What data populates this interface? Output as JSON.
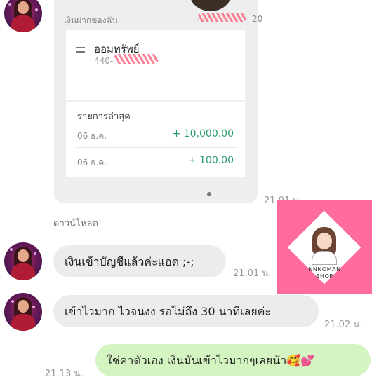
{
  "card": {
    "header_label": "เงินฝากของฉัน",
    "header_amount_suffix": "20",
    "account_name": "ออมทรัพย์",
    "account_number_prefix": "440-",
    "recent_title": "รายการล่าสุด",
    "transactions": [
      {
        "date": "06 ธ.ค.",
        "amount": "+ 10,000.00"
      },
      {
        "date": "06 ธ.ค.",
        "amount": "+ 100.00"
      }
    ],
    "time": "21.01 น."
  },
  "download_label": "ดาวน์โหลด",
  "messages": [
    {
      "text": "เงินเข้าบัญชีแล้วค่ะแอด ;-;",
      "time": "21.01 น."
    },
    {
      "text": "เข้าไวมาก ไวจนงง รอไม่ถึง 30 นาทีเลยค่ะ",
      "time": "21.02 น."
    },
    {
      "text": "ใช่ค่าตัวเอง เงินมันเข้าไวมากๆเลยน้า🥰💕",
      "time": "21.13 น."
    }
  ],
  "shop_logo": {
    "line1": "NNNOMAN",
    "line2": "SHOP"
  },
  "colors": {
    "amount_green": "#2a9d6a",
    "own_bubble": "#d4f5c2",
    "watermark_pink": "#ff6b9b"
  }
}
